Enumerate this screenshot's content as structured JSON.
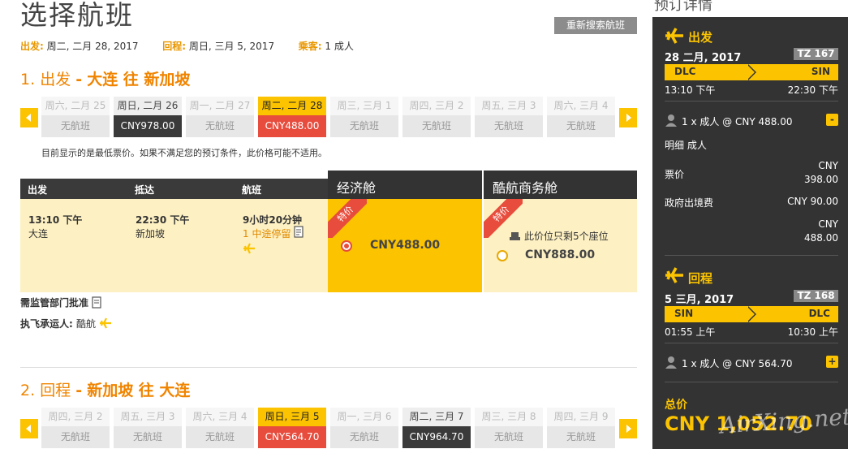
{
  "page": {
    "title": "选择航班",
    "research_button": "重新搜索航班",
    "summary": {
      "depart_label": "出发:",
      "depart_value": "周二, 二月 28, 2017",
      "return_label": "回程:",
      "return_value": "周日, 三月 5, 2017",
      "pax_label": "乘客:",
      "pax_value": "1 成人"
    }
  },
  "outbound": {
    "num": "1.",
    "dir": "出发",
    "dash": "-",
    "route": "大连 往 新加坡",
    "days": [
      {
        "label": "周六, 二月 25",
        "price": "无航班",
        "state": "none"
      },
      {
        "label": "周日, 二月 26",
        "price": "CNY978.00",
        "state": "avail"
      },
      {
        "label": "周一, 二月 27",
        "price": "无航班",
        "state": "none"
      },
      {
        "label": "周二, 二月 28",
        "price": "CNY488.00",
        "state": "sel"
      },
      {
        "label": "周三, 三月 1",
        "price": "无航班",
        "state": "none"
      },
      {
        "label": "周四, 三月 2",
        "price": "无航班",
        "state": "none"
      },
      {
        "label": "周五, 三月 3",
        "price": "无航班",
        "state": "none"
      },
      {
        "label": "周六, 三月 4",
        "price": "无航班",
        "state": "none"
      }
    ],
    "note": "目前显示的是最低票价。如果不满足您的预订条件，此价格可能不适用。",
    "table": {
      "headers": {
        "depart": "出发",
        "arrive": "抵达",
        "flight": "航班"
      },
      "depart_time": "13:10 下午",
      "depart_city": "大连",
      "arrive_time": "22:30 下午",
      "arrive_city": "新加坡",
      "duration": "9小时20分钟",
      "stops": "1 中途停留",
      "economy": {
        "name": "经济舱",
        "ribbon": "特价",
        "price": "CNY488.00"
      },
      "business": {
        "name": "酷航商务舱",
        "ribbon": "特价",
        "seats_note": "此价位只剩5个座位",
        "price": "CNY888.00"
      }
    },
    "regulated": "需监管部门批准",
    "carrier_label": "执飞承运人:",
    "carrier_value": "酷航"
  },
  "inbound": {
    "num": "2.",
    "dir": "回程",
    "dash": "-",
    "route": "新加坡 往 大连",
    "days": [
      {
        "label": "周四, 三月 2",
        "price": "无航班",
        "state": "none"
      },
      {
        "label": "周五, 三月 3",
        "price": "无航班",
        "state": "none"
      },
      {
        "label": "周六, 三月 4",
        "price": "无航班",
        "state": "none"
      },
      {
        "label": "周日, 三月 5",
        "price": "CNY564.70",
        "state": "sel"
      },
      {
        "label": "周一, 三月 6",
        "price": "无航班",
        "state": "none"
      },
      {
        "label": "周二, 三月 7",
        "price": "CNY964.70",
        "state": "avail"
      },
      {
        "label": "周三, 三月 8",
        "price": "无航班",
        "state": "none"
      },
      {
        "label": "周四, 三月 9",
        "price": "无航班",
        "state": "none"
      }
    ]
  },
  "sidebar": {
    "title": "预订详情",
    "out": {
      "label": "出发",
      "date": "28 二月, 2017",
      "flight_no": "TZ 167",
      "from": "DLC",
      "to": "SIN",
      "dep_time": "13:10 下午",
      "arr_time": "22:30 下午",
      "pax_price": "1 x 成人 @ CNY 488.00",
      "toggle": "-",
      "detail_title": "明细 成人",
      "fare_label": "票价",
      "fare_cur": "CNY",
      "fare_val": "398.00",
      "tax_label": "政府出境费",
      "tax_val": "CNY 90.00",
      "sub_cur": "CNY",
      "sub_val": "488.00"
    },
    "ret": {
      "label": "回程",
      "date": "5 三月, 2017",
      "flight_no": "TZ 168",
      "from": "SIN",
      "to": "DLC",
      "dep_time": "01:55 上午",
      "arr_time": "10:30 上午",
      "pax_price": "1 x 成人 @ CNY 564.70",
      "toggle": "+"
    },
    "total_label": "总价",
    "total_amount": "CNY 1,052.70",
    "watermark": "AirXing.net"
  }
}
